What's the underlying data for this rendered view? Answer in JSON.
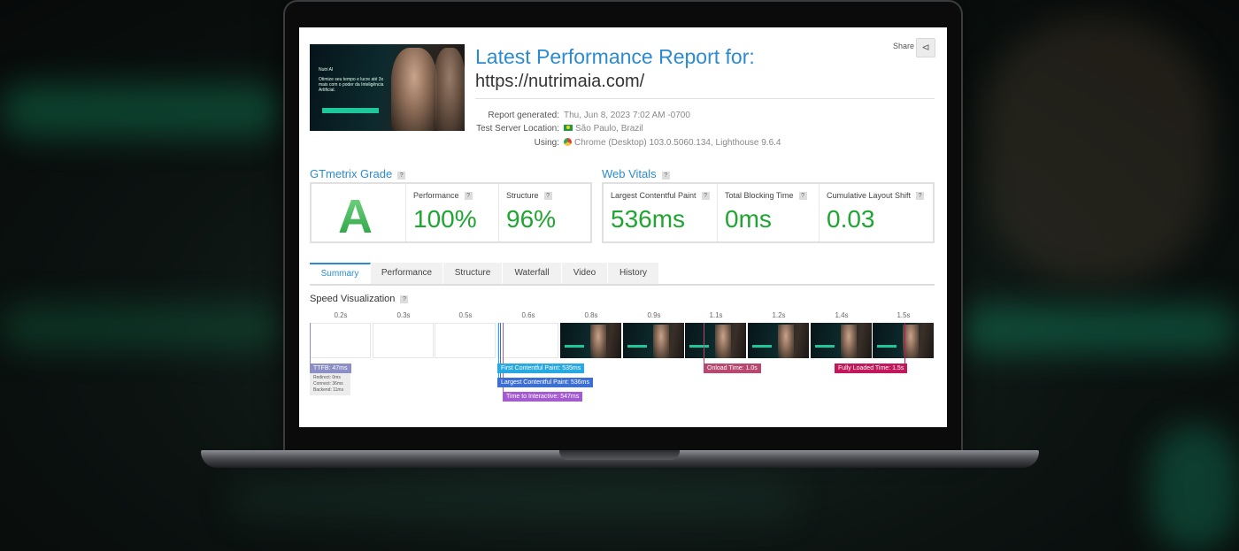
{
  "report": {
    "title": "Latest Performance Report for:",
    "url": "https://nutrimaia.com/",
    "share_label": "Share",
    "meta": [
      {
        "label": "Report generated:",
        "value": "Thu, Jun 8, 2023 7:02 AM -0700"
      },
      {
        "label": "Test Server Location:",
        "value": "São Paulo, Brazil"
      },
      {
        "label": "Using:",
        "value": "Chrome (Desktop) 103.0.5060.134, Lighthouse 9.6.4"
      }
    ]
  },
  "thumbnail": {
    "brand": "Nutri AI",
    "headline": "Otimize seu tempo e lucre até 3x mais com o poder da Inteligência Artificial."
  },
  "grade": {
    "section_title": "GTmetrix Grade",
    "letter": "A",
    "performance_label": "Performance",
    "performance_value": "100%",
    "structure_label": "Structure",
    "structure_value": "96%"
  },
  "vitals": {
    "section_title": "Web Vitals",
    "lcp_label": "Largest Contentful Paint",
    "lcp_value": "536ms",
    "tbt_label": "Total Blocking Time",
    "tbt_value": "0ms",
    "cls_label": "Cumulative Layout Shift",
    "cls_value": "0.03"
  },
  "tabs": [
    "Summary",
    "Performance",
    "Structure",
    "Waterfall",
    "Video",
    "History"
  ],
  "speed": {
    "title": "Speed Visualization",
    "ticks": [
      "0.2s",
      "0.3s",
      "0.5s",
      "0.6s",
      "0.8s",
      "0.9s",
      "1.1s",
      "1.2s",
      "1.4s",
      "1.5s"
    ],
    "markers": {
      "ttfb": "TTFB: 47ms",
      "fcp": "First Contentful Paint: 535ms",
      "lcp": "Largest Contentful Paint: 536ms",
      "tti": "Time to Interactive: 547ms",
      "onload": "Onload Time: 1.0s",
      "fully_loaded": "Fully Loaded Time: 1.5s"
    },
    "ttfb_breakdown": {
      "redirect": "Redirect: 0ms",
      "connect": "Connect: 36ms",
      "backend": "Backend: 11ms"
    }
  },
  "colors": {
    "accent": "#2c8bd0",
    "grade_green": "#1fa531",
    "ttfb": "#8c8ec6",
    "fcp": "#27a9e1",
    "lcp": "#3c6fd1",
    "tti": "#a45ad0",
    "onload": "#b8486f",
    "fully_loaded": "#c2185b"
  }
}
